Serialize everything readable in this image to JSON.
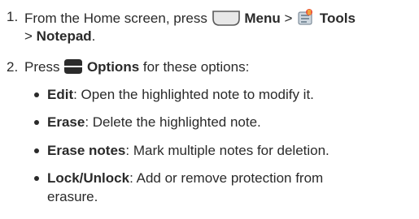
{
  "step1": {
    "number": "1.",
    "prefix": "From the Home screen, press",
    "menu_icon": "menu-key-icon",
    "menu": "Menu",
    "sep1": ">",
    "tools_icon": "tools-icon",
    "tools": "Tools",
    "sep2": ">",
    "notepad": "Notepad",
    "period": "."
  },
  "step2": {
    "number": "2.",
    "prefix": "Press",
    "options_icon": "options-key-icon",
    "options": "Options",
    "suffix": "for these options:"
  },
  "bullets": [
    {
      "term": "Edit",
      "desc": ": Open the highlighted note to modify it."
    },
    {
      "term": "Erase",
      "desc": ": Delete the highlighted note."
    },
    {
      "term": "Erase notes",
      "desc": ": Mark multiple notes for deletion."
    },
    {
      "term": "Lock/Unlock",
      "desc": ": Add or remove protection from",
      "desc_cont": "erasure."
    }
  ],
  "colors": {
    "text": "#2a2a2a",
    "key_dark": "#2b2b2b"
  }
}
